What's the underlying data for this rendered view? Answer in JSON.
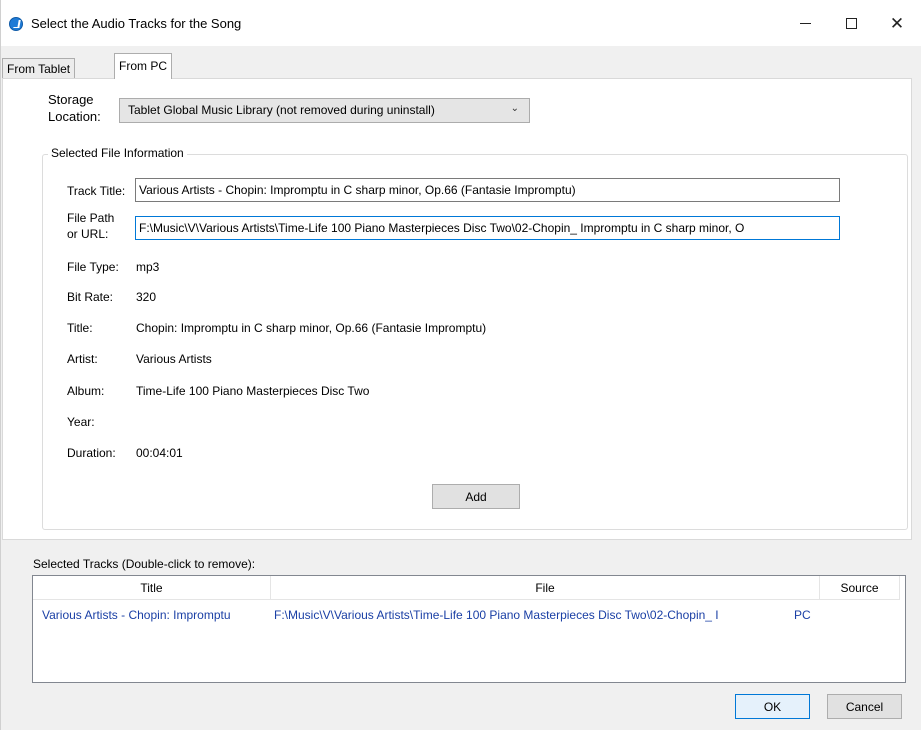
{
  "window": {
    "title": "Select the Audio Tracks for the Song",
    "minimize_glyph": "—",
    "maximize_glyph": "☐",
    "close_glyph": "✕"
  },
  "tabs": [
    {
      "label": "From Tablet",
      "selected": false
    },
    {
      "label": "From PC",
      "selected": true
    }
  ],
  "storage": {
    "label": "Storage Location:",
    "selected": "Tablet Global Music Library (not removed during uninstall)"
  },
  "file_info": {
    "group_title": "Selected File Information",
    "track_title_label": "Track Title:",
    "track_title_value": "Various Artists - Chopin: Impromptu in C sharp minor, Op.66 (Fantasie Impromptu)",
    "file_path_label": "File Path or URL:",
    "file_path_value": "F:\\Music\\V\\Various Artists\\Time-Life 100 Piano Masterpieces Disc Two\\02-Chopin_ Impromptu in C sharp minor, O",
    "file_type_label": "File Type:",
    "file_type_value": "mp3",
    "bit_rate_label": "Bit Rate:",
    "bit_rate_value": "320",
    "title_label": "Title:",
    "title_value": "Chopin: Impromptu in C sharp minor, Op.66 (Fantasie Impromptu)",
    "artist_label": "Artist:",
    "artist_value": "Various Artists",
    "album_label": "Album:",
    "album_value": "Time-Life 100 Piano Masterpieces Disc Two",
    "year_label": "Year:",
    "year_value": "",
    "duration_label": "Duration:",
    "duration_value": "00:04:01",
    "add_button": "Add"
  },
  "selected_tracks": {
    "label": "Selected Tracks (Double-click to remove):",
    "columns": [
      "Title",
      "File",
      "Source"
    ],
    "rows": [
      {
        "title": "Various Artists - Chopin: Impromptu",
        "file": "F:\\Music\\V\\Various Artists\\Time-Life 100 Piano Masterpieces Disc Two\\02-Chopin_ I",
        "source": "PC"
      }
    ]
  },
  "buttons": {
    "ok": "OK",
    "cancel": "Cancel"
  },
  "colors": {
    "accent": "#0078d7",
    "list_text": "#1a3fa5"
  }
}
